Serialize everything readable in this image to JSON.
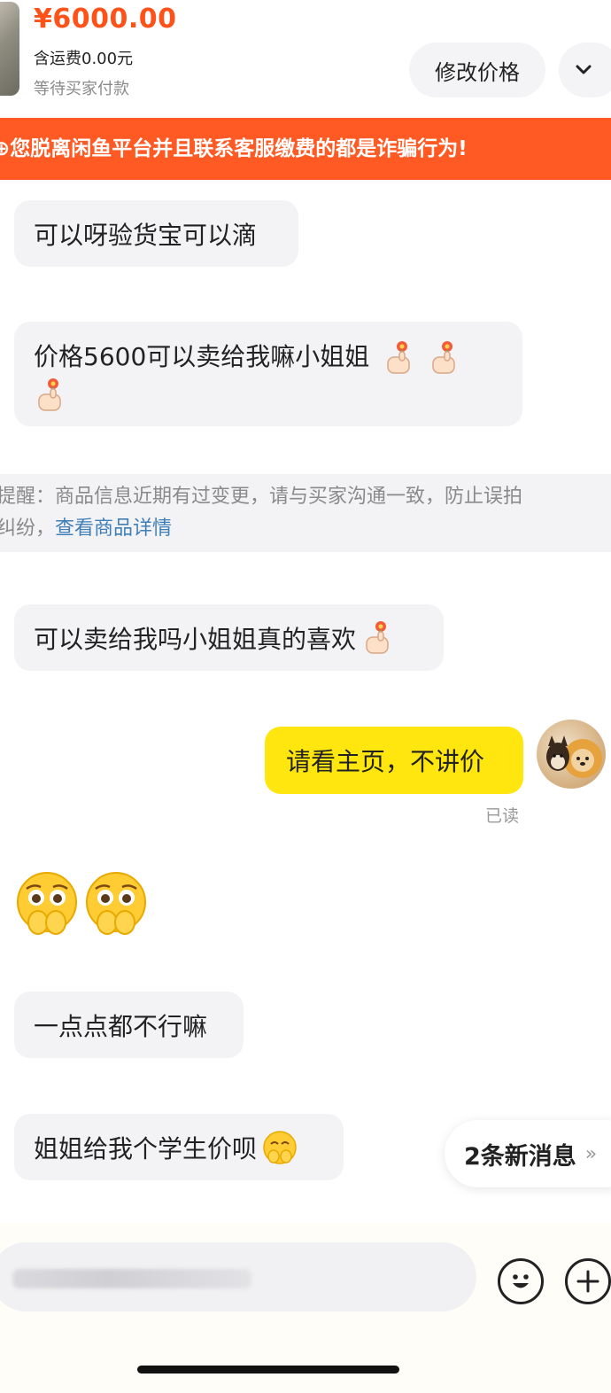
{
  "order": {
    "price": "¥6000.00",
    "shipping": "含运费0.00元",
    "status": "等待买家付款",
    "modify_button": "修改价格",
    "expand_icon": "chevron-down-icon"
  },
  "warning_banner": "⊕您脱离闲鱼平台并且联系客服缴费的都是诈骗行为!",
  "messages": [
    {
      "side": "left",
      "text": "可以呀验货宝可以滴"
    },
    {
      "side": "left",
      "text": "价格5600可以卖给我嘛小姐姐",
      "emoji": "thumb-flower-emoji"
    },
    {
      "side": "left",
      "text": "可以卖给我吗小姐姐真的喜欢",
      "emoji": "thumb-flower-emoji"
    },
    {
      "side": "right",
      "text": "请看主页，不讲价",
      "read": "已读"
    },
    {
      "side": "left",
      "sticker": "shy-face-emoji"
    },
    {
      "side": "left",
      "text": "一点点都不行嘛"
    },
    {
      "side": "left",
      "text": "姐姐给我个学生价呗",
      "emoji": "shy-face-emoji"
    }
  ],
  "system_hint": {
    "line1": "提醒：商品信息近期有过变更，请与买家沟通一致，防止误拍",
    "line2_prefix": "纠纷，",
    "link": "查看商品详情"
  },
  "new_messages": "2条新消息",
  "input": {
    "emoji_icon": "smiley-icon",
    "plus_icon": "plus-icon"
  },
  "colors": {
    "accent": "#ff5219",
    "banner": "#ff5a24",
    "my_bubble": "#ffe60f",
    "link": "#3f7fb8"
  }
}
